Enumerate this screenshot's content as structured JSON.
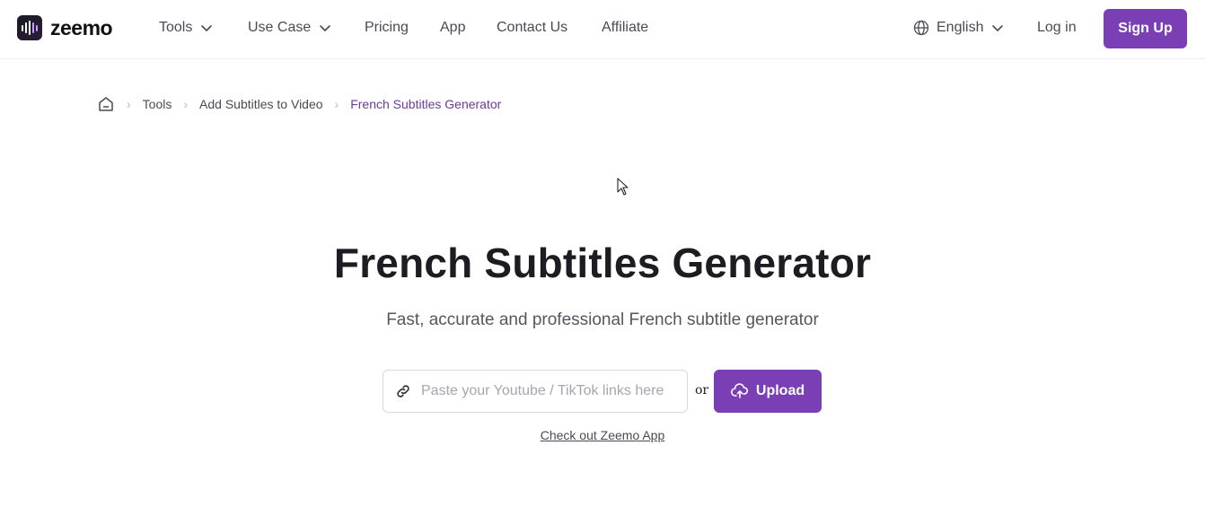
{
  "header": {
    "logo_text": "zeemo",
    "nav": [
      {
        "label": "Tools",
        "has_dropdown": true
      },
      {
        "label": "Use Case",
        "has_dropdown": true
      },
      {
        "label": "Pricing",
        "has_dropdown": false
      },
      {
        "label": "App",
        "has_dropdown": false
      },
      {
        "label": "Contact Us",
        "has_dropdown": false
      },
      {
        "label": "Affiliate",
        "has_dropdown": false
      }
    ],
    "language": "English",
    "login_label": "Log in",
    "signup_label": "Sign Up"
  },
  "breadcrumb": {
    "home_icon": "home-icon",
    "items": [
      "Tools",
      "Add Subtitles to Video"
    ],
    "current": "French Subtitles Generator"
  },
  "hero": {
    "title": "French Subtitles Generator",
    "subtitle": "Fast, accurate and professional French subtitle generator",
    "input_placeholder": "Paste your Youtube / TikTok links here",
    "input_value": "",
    "or_label": "or",
    "upload_label": "Upload",
    "app_link_label": "Check out Zeemo App"
  },
  "colors": {
    "accent": "#7b3fb5",
    "breadcrumb_current": "#6b3a9a",
    "text": "#1c1c22",
    "muted": "#4a4a55"
  }
}
